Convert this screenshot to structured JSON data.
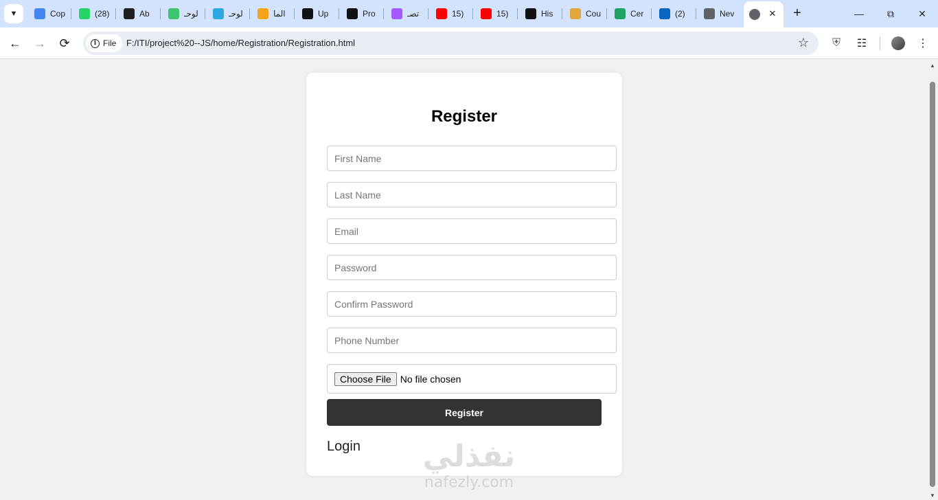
{
  "browser": {
    "tabs": [
      {
        "title": "Cop",
        "icon": "google-docs-icon",
        "color": "#4285f4"
      },
      {
        "title": "(28)",
        "icon": "whatsapp-icon",
        "color": "#25d366"
      },
      {
        "title": "Ab",
        "icon": "github-icon",
        "color": "#1f1f1f"
      },
      {
        "title": "لوحـ",
        "icon": "k-logo-icon",
        "color": "#3ec46d"
      },
      {
        "title": "لوحـ",
        "icon": "circle-logo-icon",
        "color": "#2ea6e0"
      },
      {
        "title": "الما",
        "icon": "number-five-icon",
        "color": "#f2a51a"
      },
      {
        "title": "Up",
        "icon": "upwork-icon",
        "color": "#111111"
      },
      {
        "title": "Pro",
        "icon": "upwork-icon",
        "color": "#111111"
      },
      {
        "title": "تصـ",
        "icon": "figma-icon",
        "color": "#a259ff"
      },
      {
        "title": "15)",
        "icon": "youtube-icon",
        "color": "#ff0000"
      },
      {
        "title": "15)",
        "icon": "youtube-icon",
        "color": "#ff0000"
      },
      {
        "title": "His",
        "icon": "upwork-icon",
        "color": "#111111"
      },
      {
        "title": "Cou",
        "icon": "person-icon",
        "color": "#e0a83a"
      },
      {
        "title": "Cer",
        "icon": "google-drive-icon",
        "color": "#1fa463"
      },
      {
        "title": "(2)",
        "icon": "linkedin-icon",
        "color": "#0a66c2"
      },
      {
        "title": "Nev",
        "icon": "chrome-icon",
        "color": "#5f6368"
      }
    ],
    "address": {
      "chip": "File",
      "url": "F:/ITI/project%20--JS/home/Registration/Registration.html"
    }
  },
  "form": {
    "title": "Register",
    "fields": {
      "first_name": "First Name",
      "last_name": "Last Name",
      "email": "Email",
      "password": "Password",
      "confirm_password": "Confirm Password",
      "phone": "Phone Number"
    },
    "file": {
      "button": "Choose File",
      "status": "No file chosen"
    },
    "submit": "Register",
    "login": "Login"
  },
  "watermark": {
    "arabic": "نفذلي",
    "latin": "nafezly.com"
  },
  "colors": {
    "tabstrip": "#d3e3fd",
    "page_bg": "#f1f1f1",
    "button": "#333333"
  }
}
